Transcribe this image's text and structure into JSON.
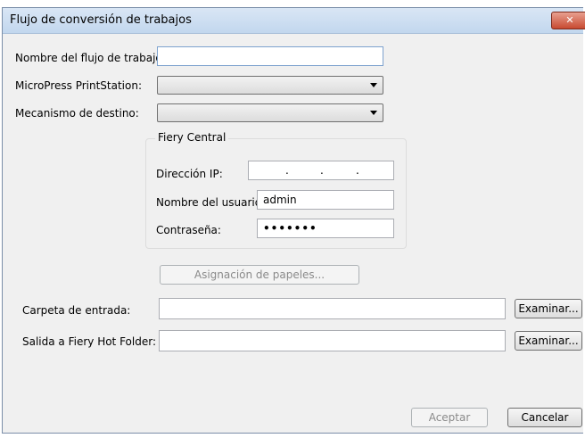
{
  "dialog": {
    "title": "Flujo de conversión de trabajos",
    "close_glyph": "✕"
  },
  "form": {
    "workflow_name_label": "Nombre del flujo de trabajo:",
    "workflow_name_value": "",
    "printstation_label": "MicroPress PrintStation:",
    "printstation_value": "",
    "destination_label": "Mecanismo de destino:",
    "destination_value": ""
  },
  "fiery_central": {
    "group_label": "Fiery Central",
    "ip_label": "Dirección IP:",
    "ip_separators": [
      ".",
      ".",
      "."
    ],
    "username_label": "Nombre del usuario:",
    "username_value": "admin",
    "password_label": "Contraseña:",
    "password_masked": "•••••••"
  },
  "paper_assignment_button": "Asignación de papeles...",
  "input_folder": {
    "label": "Carpeta de entrada:",
    "value": "",
    "browse": "Examinar..."
  },
  "output_folder": {
    "label": "Salida a Fiery Hot Folder:",
    "value": "",
    "browse": "Examinar..."
  },
  "footer": {
    "accept": "Aceptar",
    "cancel": "Cancelar"
  }
}
